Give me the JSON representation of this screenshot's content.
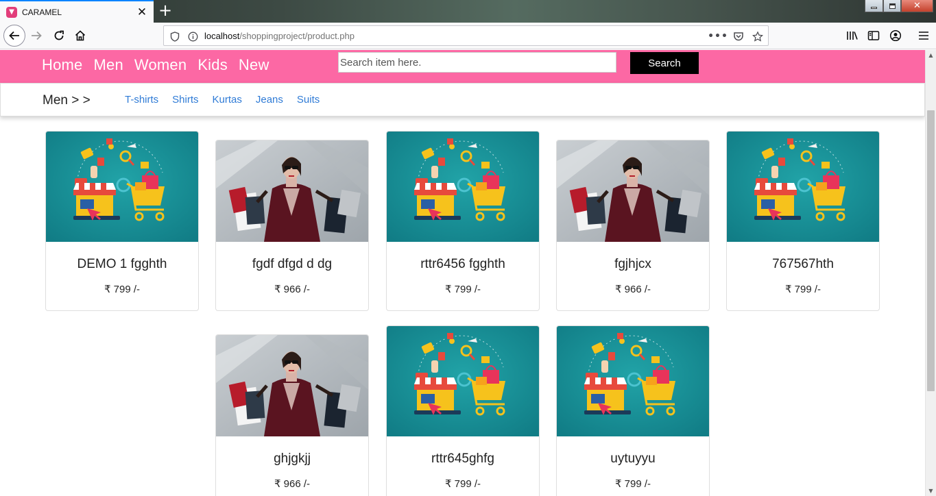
{
  "browser": {
    "tab_title": "CARAMEL",
    "url_host": "localhost",
    "url_path": "/shoppingproject/product.php"
  },
  "header": {
    "nav": [
      "Home",
      "Men",
      "Women",
      "Kids",
      "New"
    ],
    "search_placeholder": "Search item here.",
    "search_button": "Search"
  },
  "subnav": {
    "title": "Men > >",
    "links": [
      "T-shirts",
      "Shirts",
      "Kurtas",
      "Jeans",
      "Suits"
    ]
  },
  "products": [
    {
      "name": "DEMO 1 fgghth",
      "price": "₹ 799 /-",
      "image": "shopping-illustration"
    },
    {
      "name": "fgdf dfgd d dg",
      "price": "₹ 966 /-",
      "image": "shopping-woman-photo"
    },
    {
      "name": "rttr6456 fgghth",
      "price": "₹ 799 /-",
      "image": "shopping-illustration"
    },
    {
      "name": "fgjhjcx",
      "price": "₹ 966 /-",
      "image": "shopping-woman-photo"
    },
    {
      "name": "767567hth",
      "price": "₹ 799 /-",
      "image": "shopping-illustration"
    },
    {
      "name": "ghjgkjj",
      "price": "₹ 966 /-",
      "image": "shopping-woman-photo"
    },
    {
      "name": "rttr645ghfg",
      "price": "₹ 799 /-",
      "image": "shopping-illustration"
    },
    {
      "name": "uytuyyu",
      "price": "₹ 799 /-",
      "image": "shopping-illustration"
    }
  ],
  "colors": {
    "brand_pink": "#fc68a4",
    "link_blue": "#2f7bd6",
    "search_button_bg": "#000000"
  }
}
